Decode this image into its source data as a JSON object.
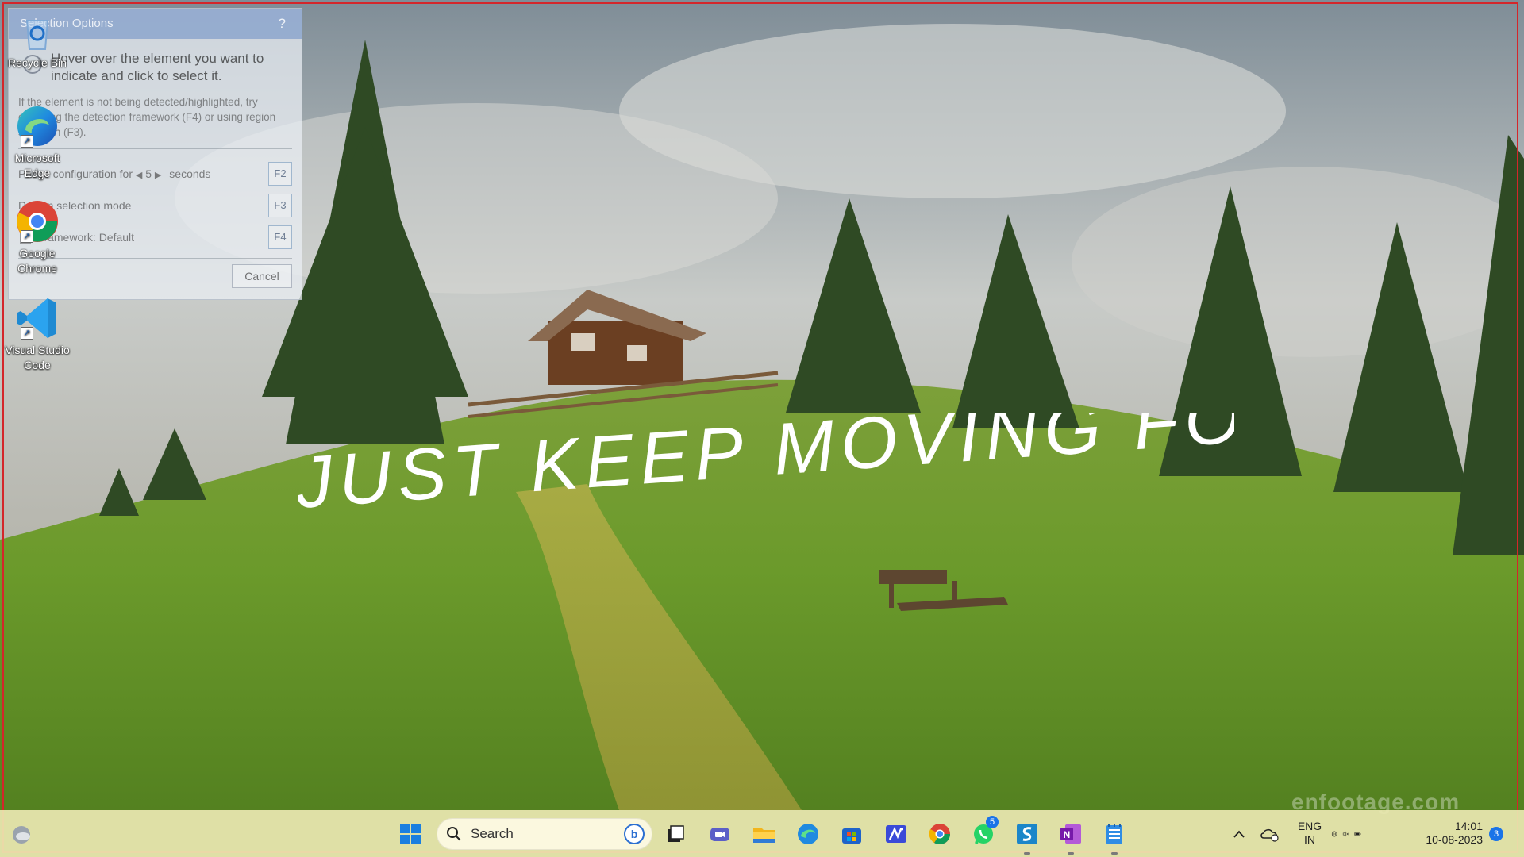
{
  "wallpaper": {
    "quote": "JUST KEEP MOVING FORWARD",
    "watermark": "enfootage.com"
  },
  "desktop_icons": [
    {
      "label": "Recycle Bin",
      "icon": "recycle-bin-icon"
    },
    {
      "label": "Microsoft Edge",
      "icon": "edge-icon"
    },
    {
      "label": "Google Chrome",
      "icon": "chrome-icon"
    },
    {
      "label": "Visual Studio Code",
      "icon": "vscode-icon"
    }
  ],
  "selection_dialog": {
    "title": "Selection Options",
    "help": "?",
    "instruction": "Hover over the element you want to indicate and click to select it.",
    "hint": "If the element is not being detected/highlighted, try changing the detection framework (F4) or using region selection (F3).",
    "pause_prefix": "Pause configuration for",
    "pause_value": "5",
    "pause_suffix": "seconds",
    "pause_key": "F2",
    "region_label": "Region selection mode",
    "region_key": "F3",
    "framework_label": "Framework:",
    "framework_value": "Default",
    "framework_key": "F4",
    "cancel": "Cancel"
  },
  "taskbar": {
    "search_placeholder": "Search",
    "whatsapp_badge": "5",
    "tray": {
      "lang_line1": "ENG",
      "lang_line2": "IN",
      "time": "14:01",
      "date": "10-08-2023",
      "notification_count": "3"
    },
    "colors": {
      "accent": "#1a73e8",
      "taskbar_bg": "#ece8b2"
    }
  }
}
